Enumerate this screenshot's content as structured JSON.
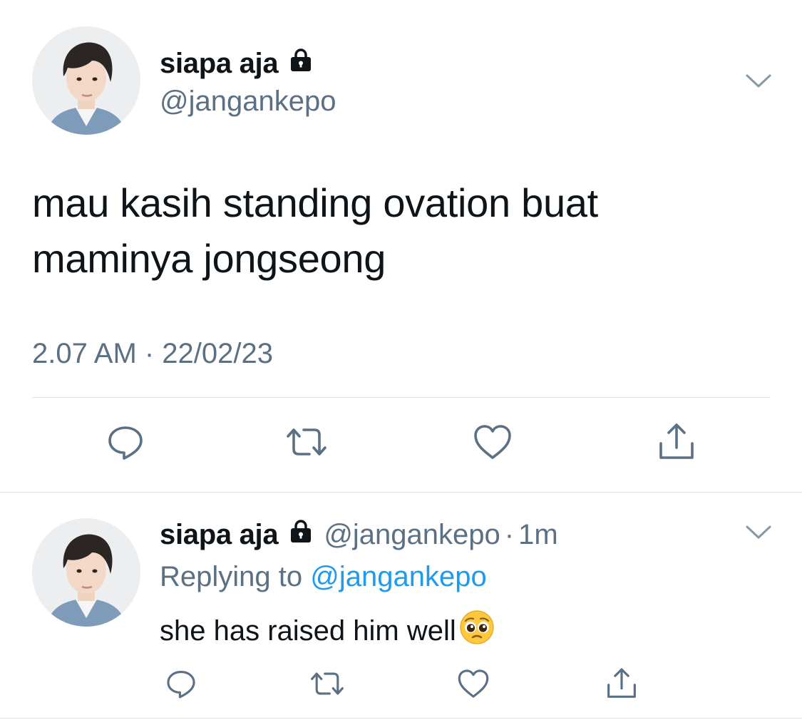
{
  "main_tweet": {
    "author_name": "siapa aja",
    "author_handle": "@jangankepo",
    "text_line1": "mau kasih standing ovation buat",
    "text_line2": "maminya jongseong",
    "timestamp": "2.07 AM · 22/02/23",
    "icons": [
      "lock-icon",
      "chevron-down-icon",
      "reply-icon",
      "retweet-icon",
      "like-icon",
      "share-icon"
    ]
  },
  "reply_tweet": {
    "author_name": "siapa aja",
    "author_handle": "@jangankepo",
    "separator": "·",
    "time": "1m",
    "replying_label": "Replying to",
    "replying_mention": "@jangankepo",
    "text": "she has raised him well",
    "emoji": "pleading-face",
    "icons": [
      "lock-icon",
      "chevron-down-icon",
      "reply-icon",
      "retweet-icon",
      "like-icon",
      "share-icon"
    ]
  },
  "colors": {
    "text_primary": "#0f1419",
    "text_secondary": "#5b7083",
    "accent_link": "#1d9bf0",
    "divider": "#dfe3e7",
    "icon_gray": "#5b7083"
  }
}
